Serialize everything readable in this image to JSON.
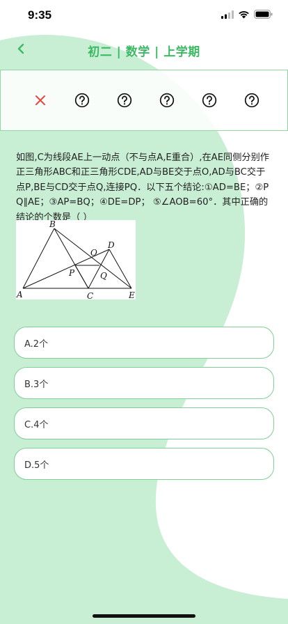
{
  "status_bar": {
    "time": "9:35"
  },
  "header": {
    "title": "初二 | 数学 | 上学期"
  },
  "progress": [
    {
      "state": "wrong",
      "icon": "close-icon"
    },
    {
      "state": "unanswered",
      "icon": "question-circle-icon"
    },
    {
      "state": "unanswered",
      "icon": "question-circle-icon"
    },
    {
      "state": "unanswered",
      "icon": "question-circle-icon"
    },
    {
      "state": "unanswered",
      "icon": "question-circle-icon"
    },
    {
      "state": "unanswered",
      "icon": "question-circle-icon"
    }
  ],
  "question": {
    "text": "如图,C为线段AE上一动点（不与点A,E重合）,在AE同侧分别作正三角形ABC和正三角形CDE,AD与BE交于点O,AD与BC交于点P,BE与CD交于点Q,连接PQ．以下五个结论:①AD=BE；②PQ∥AE；③AP=BQ；④DE=DP； ⑤∠AOB=60°．其中正确的结论的个数是（ ）",
    "figure_labels": {
      "A": "A",
      "B": "B",
      "C": "C",
      "D": "D",
      "E": "E",
      "O": "O",
      "P": "P",
      "Q": "Q"
    }
  },
  "options": [
    {
      "label": "A.2个"
    },
    {
      "label": "B.3个"
    },
    {
      "label": "C.4个"
    },
    {
      "label": "D.5个"
    }
  ],
  "colors": {
    "accent": "#3cb963",
    "background_shape": "#c8eed4",
    "wrong": "#e8473c",
    "option_border": "#7fcf96"
  }
}
